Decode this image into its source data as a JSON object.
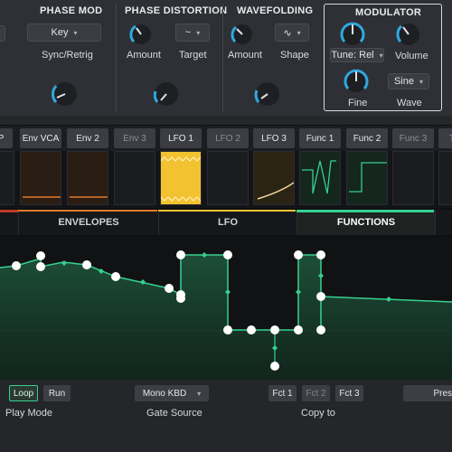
{
  "synth": {
    "phase_mod": {
      "title": "PHASE MOD",
      "mode_value": "Key",
      "mode_label": "Sync/Retrig"
    },
    "phase_distortion": {
      "title": "PHASE DISTORTION",
      "amount_label": "Amount",
      "target_label": "Target",
      "target_icon": "squiggle-wave-icon"
    },
    "wavefolding": {
      "title": "WAVEFOLDING",
      "amount_label": "Amount",
      "shape_label": "Shape",
      "shape_icon": "sine-wave-icon"
    },
    "modulator": {
      "title": "MODULATOR",
      "tune_value": "Tune: Rel",
      "volume_label": "Volume",
      "fine_label": "Fine",
      "wave_value": "Sine",
      "wave_label": "Wave"
    }
  },
  "source_tabs": [
    {
      "label": "P",
      "dim": false
    },
    {
      "label": "Env VCA",
      "dim": false
    },
    {
      "label": "Env 2",
      "dim": false
    },
    {
      "label": "Env 3",
      "dim": true
    },
    {
      "label": "LFO 1",
      "dim": false
    },
    {
      "label": "LFO 2",
      "dim": true
    },
    {
      "label": "LFO 3",
      "dim": false
    },
    {
      "label": "Func 1",
      "dim": false
    },
    {
      "label": "Func 2",
      "dim": false
    },
    {
      "label": "Func 3",
      "dim": true
    },
    {
      "label": "T",
      "dim": true
    }
  ],
  "section_tabs": {
    "envelopes": "ENVELOPES",
    "lfo": "LFO",
    "functions": "FUNCTIONS",
    "active": "functions"
  },
  "bottom": {
    "loop": "Loop",
    "run": "Run",
    "play_mode_label": "Play Mode",
    "gate_source_value": "Mono KBD",
    "gate_source_label": "Gate Source",
    "copy_buttons": [
      "Fct 1",
      "Fct 2",
      "Fct 3"
    ],
    "copy_label": "Copy to",
    "preset_partial": "Pres"
  },
  "colors": {
    "accent_green": "#36d18f",
    "knob_blue": "#2fa8e0",
    "lfo_yellow": "#f2c230",
    "env_orange": "#e07a2a"
  }
}
